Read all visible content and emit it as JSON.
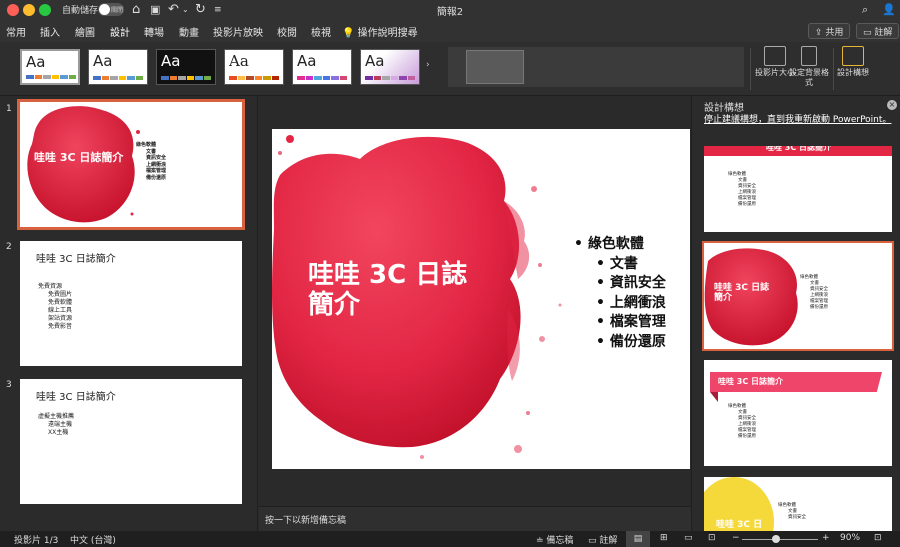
{
  "titlebar": {
    "autosave_label": "自動儲存",
    "toggle_state": "關閉",
    "title": "簡報2"
  },
  "tabs": [
    {
      "label": "常用"
    },
    {
      "label": "插入"
    },
    {
      "label": "繪圖"
    },
    {
      "label": "設計"
    },
    {
      "label": "轉場"
    },
    {
      "label": "動畫"
    },
    {
      "label": "投影片放映"
    },
    {
      "label": "校閱"
    },
    {
      "label": "檢視"
    }
  ],
  "help_label": "操作說明搜尋",
  "share_label": "共用",
  "comments_label": "註解",
  "themes": [
    {
      "label": "Aa"
    },
    {
      "label": "Aa"
    },
    {
      "label": "Aa"
    },
    {
      "label": "Aa"
    },
    {
      "label": "Aa"
    },
    {
      "label": "Aa"
    }
  ],
  "ribbon_buttons": {
    "slide_size": "投影片大小",
    "format_background": "設定背景格式",
    "design_ideas": "設計構想"
  },
  "thumbnails": [
    {
      "num": "1",
      "title": "哇哇 3C 日誌簡介"
    },
    {
      "num": "2",
      "title": "哇哇 3C 日誌簡介",
      "items": [
        "免費資源",
        "免費圖片",
        "免費軟體",
        "線上工具",
        "架站資源",
        "免費影音"
      ]
    },
    {
      "num": "3",
      "title": "哇哇 3C 日誌簡介",
      "items": [
        "虛擬主機推薦",
        "遠端主機",
        "XX主機"
      ]
    }
  ],
  "slide": {
    "title_line1": "哇哇 3C 日誌",
    "title_line2": "簡介",
    "bullet_main": "綠色軟體",
    "bullets": [
      "文書",
      "資訊安全",
      "上網衝浪",
      "檔案管理",
      "備份還原"
    ]
  },
  "notes_placeholder": "按一下以新增備忘稿",
  "ideas": {
    "title": "設計構想",
    "link": "停止建議構想，直到我重新啟動 PowerPoint。",
    "idea3_title": "哇哇 3C 日誌簡介",
    "idea4_title": "哇哇 3C 日"
  },
  "status": {
    "slide_count": "投影片 1/3",
    "language": "中文 (台灣)",
    "notes": "備忘稿",
    "comments": "註解",
    "zoom": "90%"
  },
  "colors": {
    "accent_red": "#e22644",
    "selection_orange": "#d8623f",
    "banner_pink": "#f0456a",
    "yellow": "#f5d83a"
  }
}
